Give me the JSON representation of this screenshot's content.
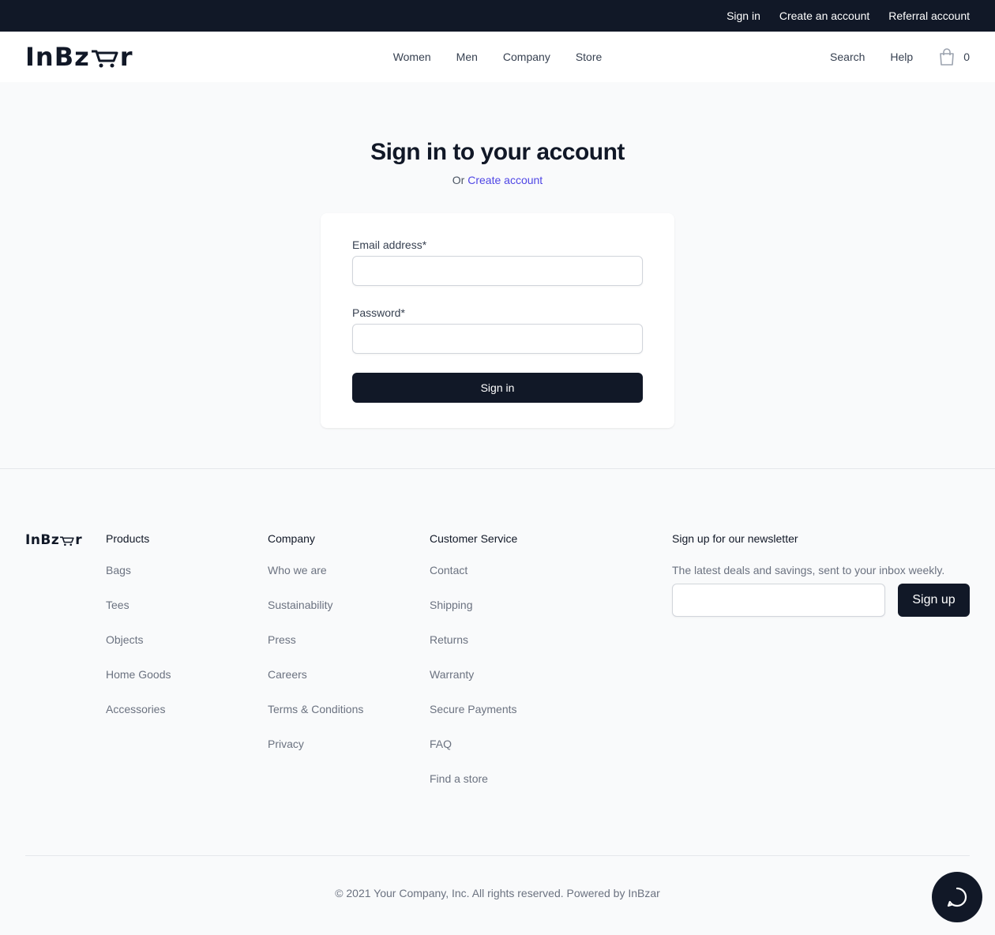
{
  "topbar": {
    "links": [
      "Sign in",
      "Create an account",
      "Referral account"
    ]
  },
  "header": {
    "logo_text": "InBz",
    "logo_tail": "r",
    "nav": [
      "Women",
      "Men",
      "Company",
      "Store"
    ],
    "search_label": "Search",
    "help_label": "Help",
    "cart_count": "0"
  },
  "signin": {
    "title": "Sign in to your account",
    "or_text": "Or",
    "create_link": "Create account",
    "email_label": "Email address*",
    "email_value": "",
    "password_label": "Password*",
    "password_value": "",
    "submit_label": "Sign in"
  },
  "footer": {
    "products": {
      "title": "Products",
      "items": [
        "Bags",
        "Tees",
        "Objects",
        "Home Goods",
        "Accessories"
      ]
    },
    "company": {
      "title": "Company",
      "items": [
        "Who we are",
        "Sustainability",
        "Press",
        "Careers",
        "Terms & Conditions",
        "Privacy"
      ]
    },
    "customer_service": {
      "title": "Customer Service",
      "items": [
        "Contact",
        "Shipping",
        "Returns",
        "Warranty",
        "Secure Payments",
        "FAQ",
        "Find a store"
      ]
    },
    "newsletter": {
      "title": "Sign up for our newsletter",
      "description": "The latest deals and savings, sent to your inbox weekly.",
      "input_value": "",
      "button_label": "Sign up"
    },
    "copyright": "© 2021 Your Company, Inc. All rights reserved. Powered by InBzar"
  },
  "colors": {
    "dark": "#111827",
    "accent": "#4f46e5",
    "background": "#f9fafb"
  },
  "icons": {
    "cart": "shopping-bag-icon",
    "chat": "chat-bubble-icon",
    "logo_cart": "cart-icon"
  }
}
